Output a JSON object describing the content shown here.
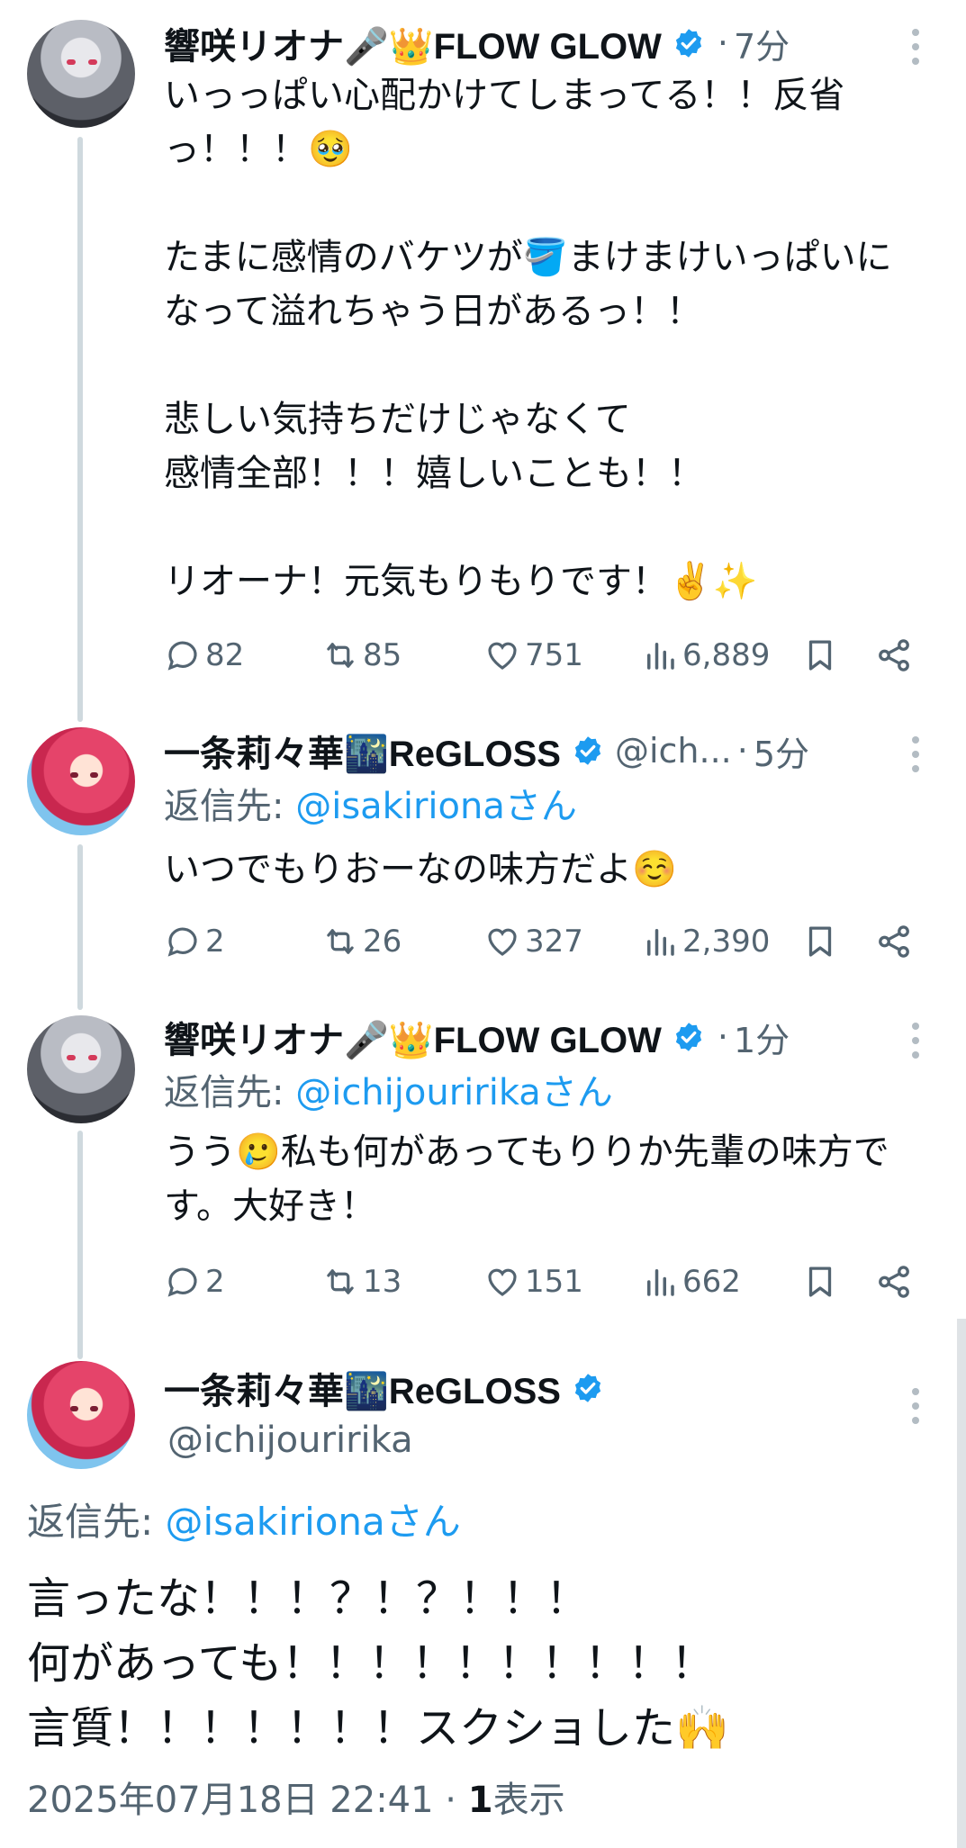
{
  "tweets": [
    {
      "name": "響咲リオナ🎤👑FLOW GLOW",
      "handle": "",
      "time": "7分",
      "reply_prefix": "",
      "reply_to": "",
      "text": "いっっぱい心配かけてしまってる！！反省っ！！！🥹\n\nたまに感情のバケツが🪣まけまけいっぱいになって溢れちゃう日があるっ！！\n\n悲しい気持ちだけじゃなくて\n感情全部！！！嬉しいことも！！\n\nリオーナ！元気もりもりです！✌️✨",
      "replies": "82",
      "reposts": "85",
      "likes": "751",
      "views": "6,889"
    },
    {
      "name": "一条莉々華🌃ReGLOSS",
      "handle": "@ich...",
      "time": "5分",
      "reply_prefix": "返信先: ",
      "reply_to": "@isakirionaさん",
      "text": "いつでもりおーなの味方だよ☺️",
      "replies": "2",
      "reposts": "26",
      "likes": "327",
      "views": "2,390"
    },
    {
      "name": "響咲リオナ🎤👑FLOW GLOW",
      "handle": "",
      "time": "1分",
      "reply_prefix": "返信先: ",
      "reply_to": "@ichijouririkaさん",
      "text": "うう🥲私も何があってもりりか先輩の味方です。大好き！",
      "replies": "2",
      "reposts": "13",
      "likes": "151",
      "views": "662"
    }
  ],
  "main": {
    "name": "一条莉々華🌃ReGLOSS",
    "handle": "@ichijouririka",
    "reply_prefix": "返信先: ",
    "reply_to": "@isakirionaさん",
    "text": "言ったな！！！？！？！！！\n何があっても！！！！！！！！！！\n言質！！！！！！！スクショした🙌",
    "date": "2025年07月18日 22:41",
    "separator": " · ",
    "views_count": "1",
    "views_label": "表示"
  },
  "colors": {
    "accent": "#1d9bf0",
    "muted": "#536471",
    "text": "#0f1419",
    "line": "#cfd9de"
  }
}
